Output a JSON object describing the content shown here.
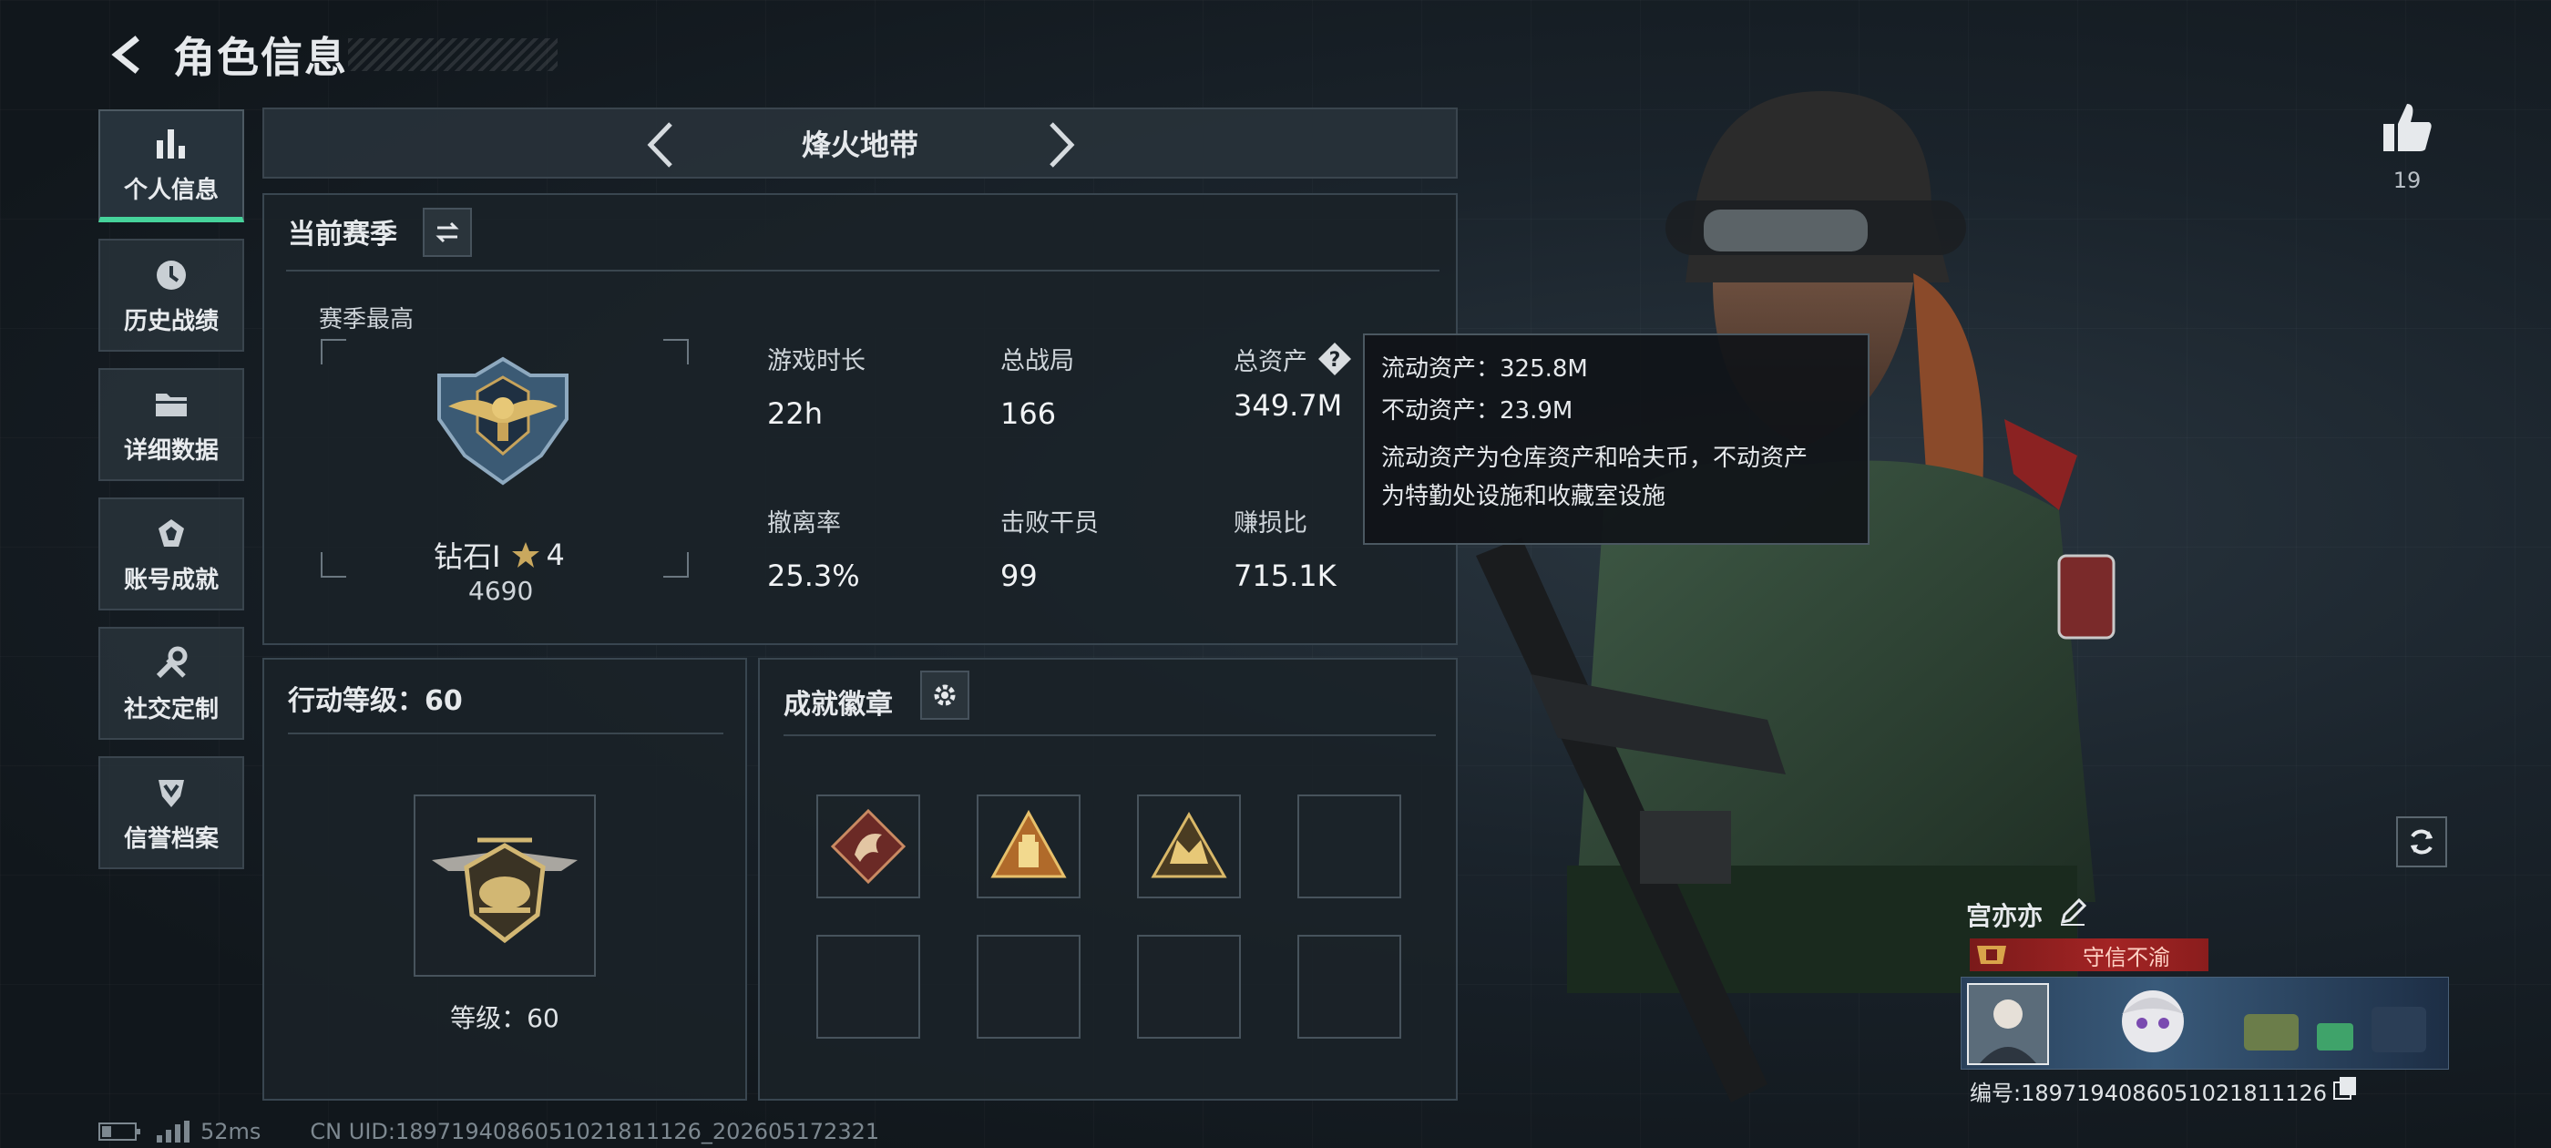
{
  "header": {
    "title": "角色信息"
  },
  "nav": {
    "items": [
      {
        "label": "个人信息",
        "icon": "bar-chart-icon",
        "active": true
      },
      {
        "label": "历史战绩",
        "icon": "history-clock-icon",
        "active": false
      },
      {
        "label": "详细数据",
        "icon": "folder-icon",
        "active": false
      },
      {
        "label": "账号成就",
        "icon": "achievement-icon",
        "active": false
      },
      {
        "label": "社交定制",
        "icon": "tools-icon",
        "active": false
      },
      {
        "label": "信誉档案",
        "icon": "shield-icon",
        "active": false
      }
    ]
  },
  "mode": {
    "title": "烽火地带"
  },
  "season": {
    "title": "当前赛季",
    "best_label": "赛季最高",
    "rank_name": "钻石I",
    "rank_stars": "4",
    "rank_points": "4690",
    "stats": [
      {
        "label": "游戏时长",
        "value": "22h"
      },
      {
        "label": "总战局",
        "value": "166"
      },
      {
        "label": "总资产",
        "value": "349.7M"
      },
      {
        "label": "撤离率",
        "value": "25.3%"
      },
      {
        "label": "击败干员",
        "value": "99"
      },
      {
        "label": "赚损比",
        "value": "715.1K"
      }
    ]
  },
  "tooltip": {
    "liquid": "流动资产：325.8M",
    "fixed": "不动资产：23.9M",
    "note_line1": "流动资产为仓库资产和哈夫币，不动资产",
    "note_line2": "为特勤处设施和收藏室设施"
  },
  "action_level": {
    "title": "行动等级：60",
    "level_label": "等级：60"
  },
  "badges": {
    "title": "成就徽章",
    "items": [
      {
        "icon": "dragon-badge-icon",
        "filled": true
      },
      {
        "icon": "pyramid-badge-icon",
        "filled": true
      },
      {
        "icon": "crown-badge-icon",
        "filled": true
      },
      {
        "icon": "",
        "filled": false
      },
      {
        "icon": "",
        "filled": false
      },
      {
        "icon": "",
        "filled": false
      },
      {
        "icon": "",
        "filled": false
      },
      {
        "icon": "",
        "filled": false
      }
    ]
  },
  "likes": {
    "count": "19"
  },
  "player": {
    "name": "宫亦亦",
    "title": "守信不渝",
    "id_line": "编号:1897194086051021811126"
  },
  "status": {
    "ping": "52ms",
    "uid": "CN UID:1897194086051021811126_202605172321"
  },
  "colors": {
    "accent": "#46d39b",
    "panel": "#1a2228",
    "title_tag": "#a32424"
  }
}
